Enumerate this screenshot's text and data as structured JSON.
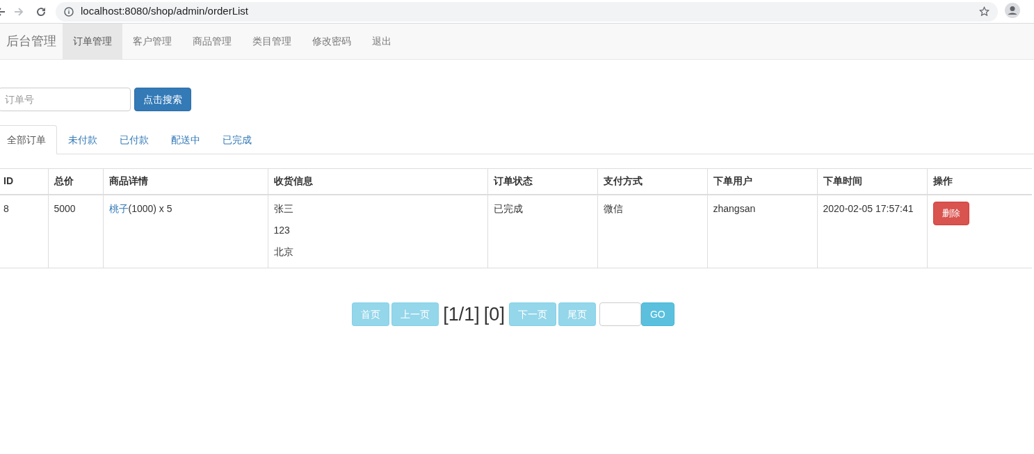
{
  "browser": {
    "url": "localhost:8080/shop/admin/orderList"
  },
  "navbar": {
    "brand": "后台管理",
    "items": [
      {
        "label": "订单管理",
        "selected": true
      },
      {
        "label": "客户管理",
        "selected": false
      },
      {
        "label": "商品管理",
        "selected": false
      },
      {
        "label": "类目管理",
        "selected": false
      },
      {
        "label": "修改密码",
        "selected": false
      },
      {
        "label": "退出",
        "selected": false
      }
    ]
  },
  "search": {
    "placeholder": "订单号",
    "button": "点击搜索"
  },
  "tabs": [
    {
      "label": "全部订单",
      "selected": true
    },
    {
      "label": "未付款",
      "selected": false
    },
    {
      "label": "已付款",
      "selected": false
    },
    {
      "label": "配送中",
      "selected": false
    },
    {
      "label": "已完成",
      "selected": false
    }
  ],
  "table": {
    "columns": [
      "ID",
      "总价",
      "商品详情",
      "收货信息",
      "订单状态",
      "支付方式",
      "下单用户",
      "下单时间",
      "操作"
    ],
    "rows": [
      {
        "id": "8",
        "total": "5000",
        "product_link": "桃子",
        "product_rest": "(1000) x 5",
        "receiver": [
          "张三",
          "123",
          "北京"
        ],
        "status": "已完成",
        "payment": "微信",
        "user": "zhangsan",
        "time": "2020-02-05 17:57:41",
        "action": "删除"
      }
    ]
  },
  "pagination": {
    "buttons": [
      {
        "label": "首页",
        "disabled": true
      },
      {
        "label": "上一页",
        "disabled": true
      }
    ],
    "page_info": "[1/1]",
    "count": "[0]",
    "buttons_after": [
      {
        "label": "下一页",
        "disabled": true
      },
      {
        "label": "尾页",
        "disabled": true
      }
    ],
    "go": "GO"
  }
}
